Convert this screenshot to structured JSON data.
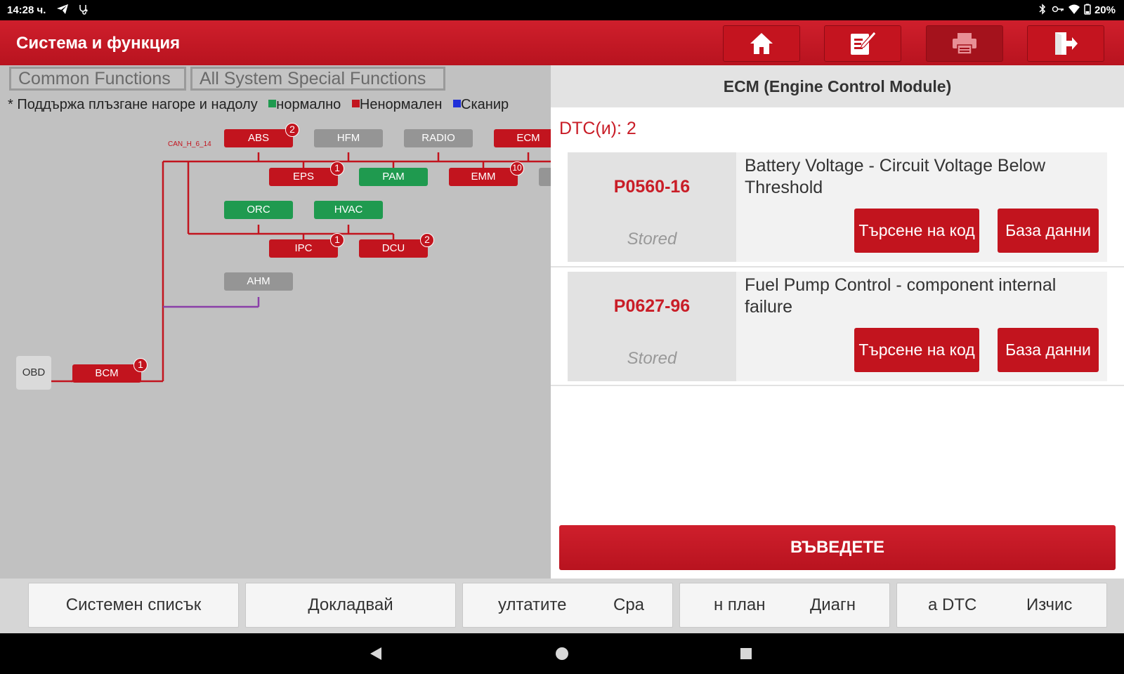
{
  "status_bar": {
    "time": "14:28 ч.",
    "battery": "20%"
  },
  "header": {
    "title": "Система и функция"
  },
  "tabs": [
    "Common Functions",
    "All System Special Functions"
  ],
  "legend": {
    "note": "* Поддържа плъзгане нагоре и надолу",
    "normal": "нормално",
    "abnormal": "Ненормален",
    "scanning": "Сканир",
    "normal_color": "#1f9a4f",
    "abnormal_color": "#c2141e",
    "scanning_color": "#1f2fd8"
  },
  "topology": {
    "bus_label": "CAN_H_6_14",
    "obd": "OBD",
    "nodes": [
      {
        "id": "abs",
        "label": "ABS",
        "status": "red",
        "badge": "2"
      },
      {
        "id": "hfm",
        "label": "HFM",
        "status": "gray",
        "badge": ""
      },
      {
        "id": "radio",
        "label": "RADIO",
        "status": "gray",
        "badge": ""
      },
      {
        "id": "ecm",
        "label": "ECM",
        "status": "red",
        "badge": ""
      },
      {
        "id": "eps",
        "label": "EPS",
        "status": "red",
        "badge": "1"
      },
      {
        "id": "pam",
        "label": "PAM",
        "status": "green",
        "badge": ""
      },
      {
        "id": "emm",
        "label": "EMM",
        "status": "red",
        "badge": "10"
      },
      {
        "id": "orc",
        "label": "ORC",
        "status": "green",
        "badge": ""
      },
      {
        "id": "hvac",
        "label": "HVAC",
        "status": "green",
        "badge": ""
      },
      {
        "id": "ipc",
        "label": "IPC",
        "status": "red",
        "badge": "1"
      },
      {
        "id": "dcu",
        "label": "DCU",
        "status": "red",
        "badge": "2"
      },
      {
        "id": "ahm",
        "label": "AHM",
        "status": "gray",
        "badge": ""
      },
      {
        "id": "bcm",
        "label": "BCM",
        "status": "red",
        "badge": "1"
      }
    ]
  },
  "panel": {
    "title": "ECM (Engine Control Module)",
    "dtc_count": "DTC(и): 2",
    "dtcs": [
      {
        "code": "P0560-16",
        "status": "Stored",
        "description": "Battery Voltage - Circuit Voltage Below Threshold",
        "search_label": "Търсене на код",
        "db_label": "База данни"
      },
      {
        "code": "P0627-96",
        "status": "Stored",
        "description": "Fuel Pump Control - component internal failure",
        "search_label": "Търсене на код",
        "db_label": "База данни"
      }
    ],
    "enter_label": "ВЪВЕДЕТЕ"
  },
  "bottom_buttons": {
    "system_list": "Системен списък",
    "report": "Докладвай",
    "compare_a": "ултатите",
    "compare_b": "Сра",
    "diag_a": "н план",
    "diag_b": "Диагн",
    "clear_a": "а DTC",
    "clear_b": "Изчис"
  }
}
